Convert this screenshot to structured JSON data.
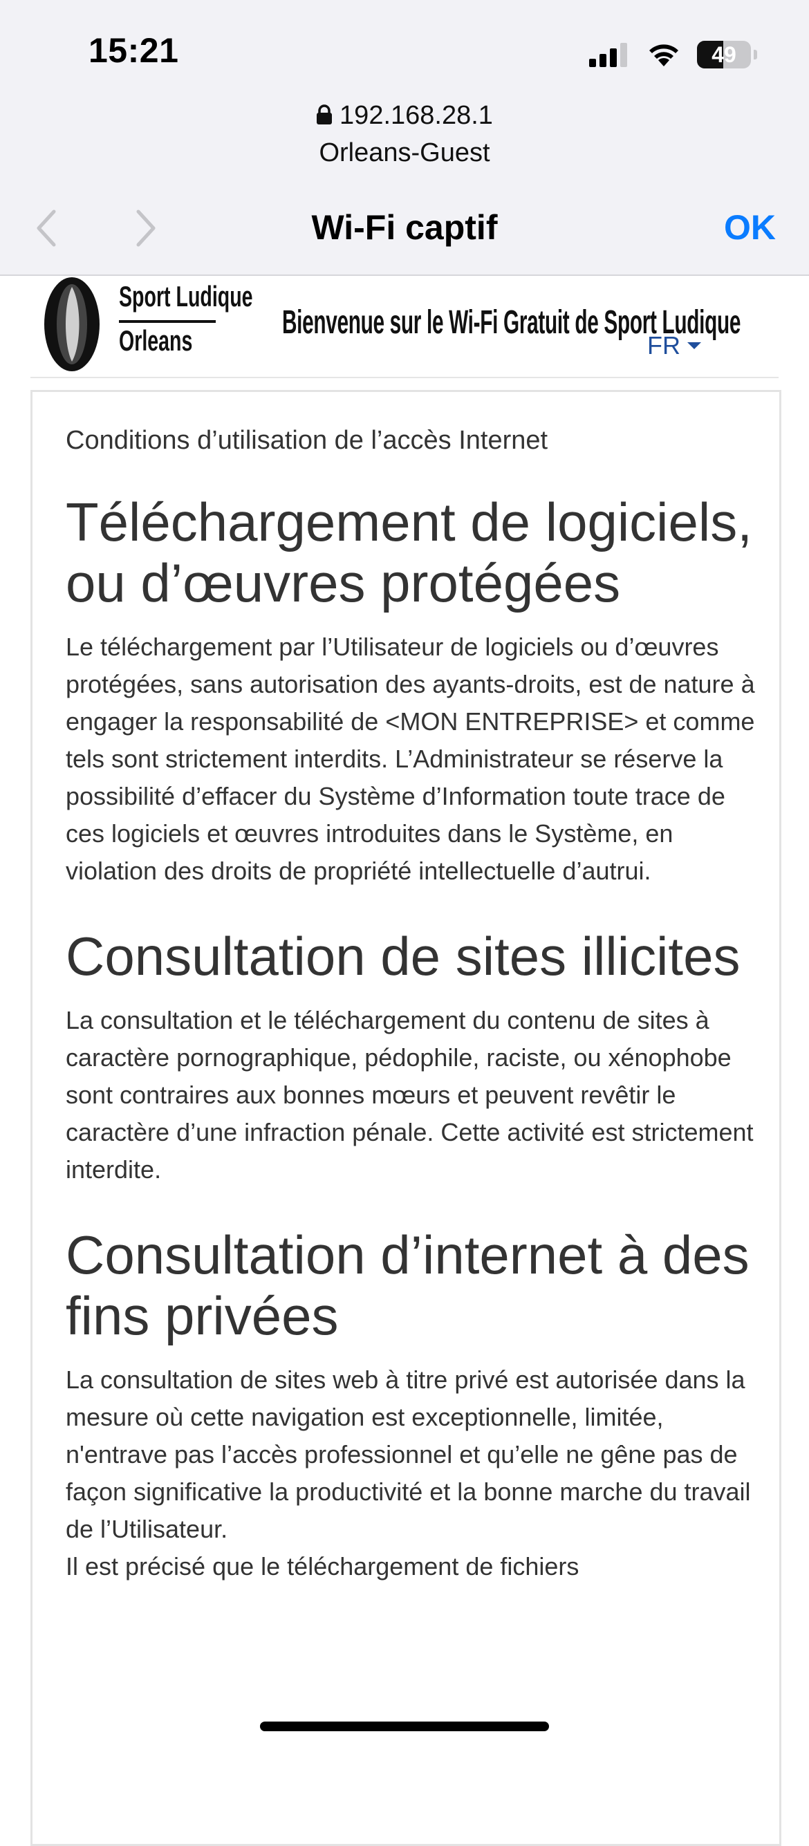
{
  "status_bar": {
    "time": "15:21",
    "battery_percent": "49",
    "icons": [
      "cellular-signal-icon",
      "wifi-icon",
      "battery-icon"
    ]
  },
  "address": {
    "host": "192.168.28.1",
    "ssid": "Orleans-Guest"
  },
  "nav_bar": {
    "title": "Wi-Fi captif",
    "ok_label": "OK",
    "ok_color": "#0a7cff"
  },
  "site_header": {
    "logo_line1": "Sport Ludique",
    "logo_line2": "Orleans",
    "welcome": "Bienvenue sur le Wi-Fi Gratuit de Sport Ludique",
    "language": "FR",
    "language_color": "#1f4e9c"
  },
  "document": {
    "caption": "Conditions d’utilisation de l’accès Internet",
    "sections": [
      {
        "heading": "Téléchargement de logiciels, ou d’œuvres protégées",
        "body": "Le téléchargement par l’Utilisateur de logiciels ou d’œuvres protégées, sans autorisation des ayants-droits, est de nature à engager la responsabilité de <MON ENTREPRISE> et comme tels sont strictement interdits. L’Administrateur se réserve la possibilité d’effacer du Système d’Information toute trace de ces logiciels et œuvres introduites dans le Système, en violation des droits de propriété intellectuelle d’autrui."
      },
      {
        "heading": "Consultation de sites illicites",
        "body": "La consultation et le téléchargement du contenu de sites à caractère pornographique, pédophile, raciste, ou xénophobe sont contraires aux bonnes mœurs et peuvent revêtir le caractère d’une infraction pénale. Cette activité est strictement interdite."
      },
      {
        "heading": "Consultation d’internet à des fins privées",
        "body": "La consultation de sites web à titre privé est autorisée dans la mesure où cette navigation est exceptionnelle, limitée, n'entrave pas l’accès professionnel et qu’elle ne gêne pas de façon significative la productivité et la bonne marche du travail de l’Utilisateur."
      }
    ],
    "trailing_text": "Il est précisé que le téléchargement de fichiers"
  }
}
